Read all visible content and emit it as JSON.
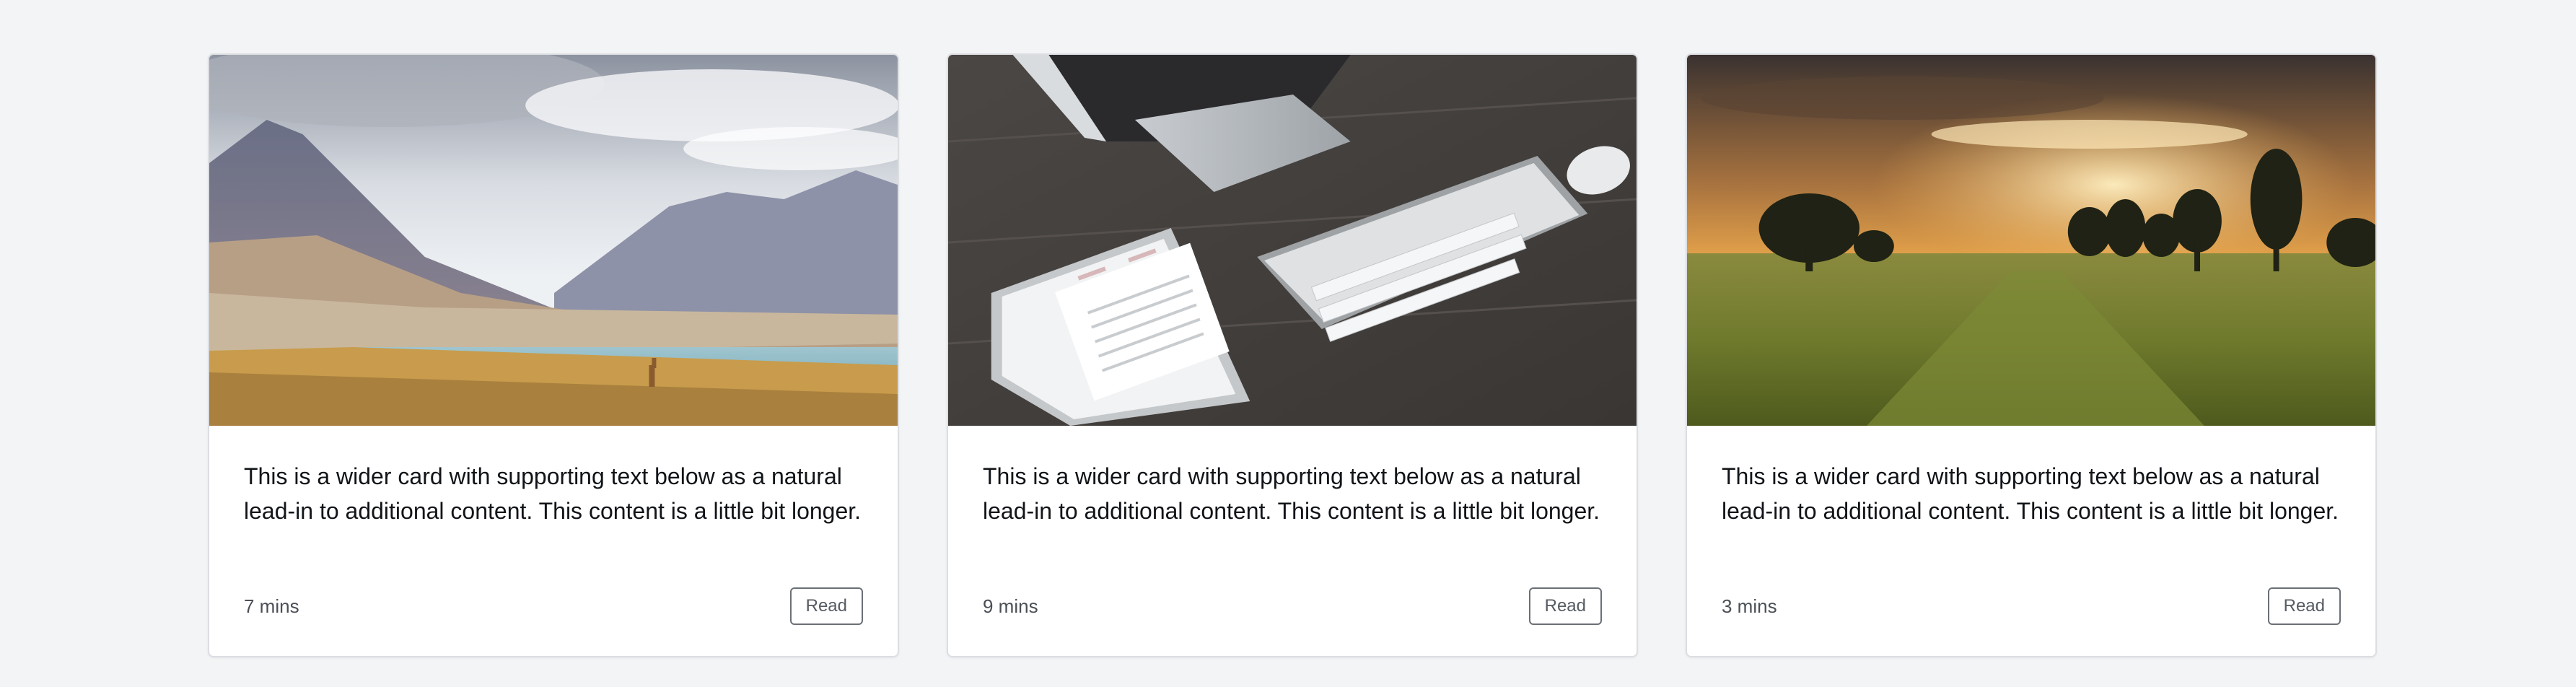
{
  "cards": [
    {
      "image": "mountain-lake-photo",
      "text": "This is a wider card with supporting text below as a natural lead-in to additional content. This content is a little bit longer.",
      "time": "7 mins",
      "button": "Read"
    },
    {
      "image": "desk-keyboard-tablet-photo",
      "text": "This is a wider card with supporting text below as a natural lead-in to additional content. This content is a little bit longer.",
      "time": "9 mins",
      "button": "Read"
    },
    {
      "image": "sunset-field-photo",
      "text": "This is a wider card with supporting text below as a natural lead-in to additional content. This content is a little bit longer.",
      "time": "3 mins",
      "button": "Read"
    }
  ],
  "colors": {
    "page_background": "#f3f4f6",
    "card_background": "#ffffff",
    "card_border": "#dcdee2",
    "button_border": "#6b7077"
  }
}
